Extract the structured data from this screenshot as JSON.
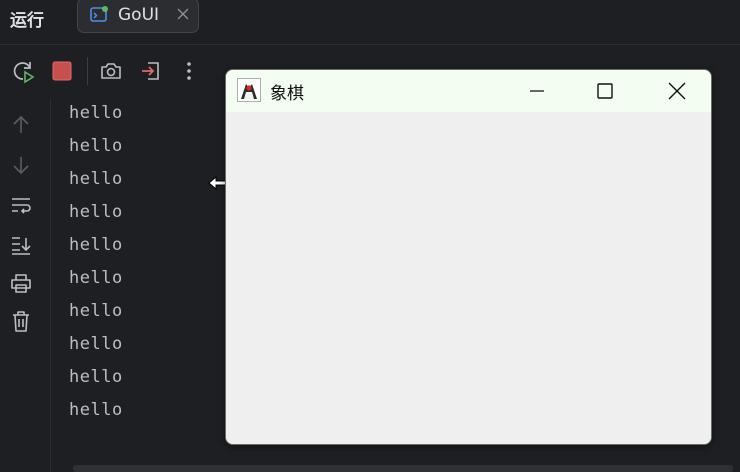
{
  "run_panel": {
    "title": "运行",
    "tab": {
      "label": "GoUI",
      "icon": "app-window-icon",
      "status_dot_color": "#5fb865"
    }
  },
  "toolbar": {
    "items": [
      "rerun-icon",
      "stop-icon",
      "camera-icon",
      "exit-icon",
      "more-vertical-icon"
    ],
    "stop_color": "#c94f4f"
  },
  "sidebar": {
    "items": [
      "arrow-up-icon",
      "arrow-down-icon",
      "soft-wrap-icon",
      "scroll-to-end-icon",
      "print-icon",
      "trash-icon"
    ]
  },
  "console": {
    "lines": [
      "hello",
      "hello",
      "hello",
      "hello",
      "hello",
      "hello",
      "hello",
      "hello",
      "hello",
      "hello"
    ]
  },
  "app_window": {
    "title": "象棋",
    "icon": "java-duke-icon",
    "controls": [
      "minimize-icon",
      "maximize-icon",
      "close-icon"
    ]
  }
}
